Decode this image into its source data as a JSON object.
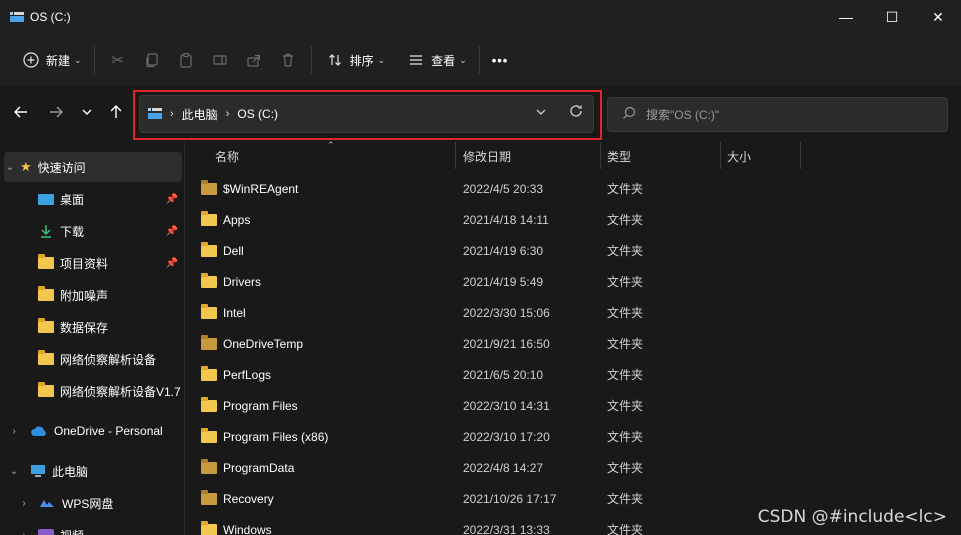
{
  "window": {
    "title": "OS (C:)",
    "minimize_glyph": "—",
    "maximize_glyph": "☐",
    "close_glyph": "✕"
  },
  "toolbar": {
    "new_label": "新建",
    "sort_label": "排序",
    "view_label": "查看",
    "more_label": "•••"
  },
  "address": {
    "crumbs": [
      "此电脑",
      "OS (C:)"
    ]
  },
  "search": {
    "placeholder": "搜索\"OS (C:)\""
  },
  "sidebar": {
    "quick_access": "快速访问",
    "items": [
      {
        "label": "桌面",
        "pinned": true
      },
      {
        "label": "下载",
        "pinned": true
      },
      {
        "label": "项目资料",
        "pinned": true
      },
      {
        "label": "附加噪声",
        "pinned": false
      },
      {
        "label": "数据保存",
        "pinned": false
      },
      {
        "label": "网络侦察解析设备",
        "pinned": false
      },
      {
        "label": "网络侦察解析设备V1.7",
        "pinned": false
      }
    ],
    "onedrive": "OneDrive - Personal",
    "this_pc": "此电脑",
    "wps": "WPS网盘",
    "videos": "视频"
  },
  "columns": {
    "name": "名称",
    "modified": "修改日期",
    "type": "类型",
    "size": "大小"
  },
  "files": [
    {
      "name": "$WinREAgent",
      "date": "2022/4/5 20:33",
      "type": "文件夹",
      "hidden": true
    },
    {
      "name": "Apps",
      "date": "2021/4/18 14:11",
      "type": "文件夹",
      "hidden": false
    },
    {
      "name": "Dell",
      "date": "2021/4/19 6:30",
      "type": "文件夹",
      "hidden": false
    },
    {
      "name": "Drivers",
      "date": "2021/4/19 5:49",
      "type": "文件夹",
      "hidden": false
    },
    {
      "name": "Intel",
      "date": "2022/3/30 15:06",
      "type": "文件夹",
      "hidden": false
    },
    {
      "name": "OneDriveTemp",
      "date": "2021/9/21 16:50",
      "type": "文件夹",
      "hidden": true
    },
    {
      "name": "PerfLogs",
      "date": "2021/6/5 20:10",
      "type": "文件夹",
      "hidden": false
    },
    {
      "name": "Program Files",
      "date": "2022/3/10 14:31",
      "type": "文件夹",
      "hidden": false
    },
    {
      "name": "Program Files (x86)",
      "date": "2022/3/10 17:20",
      "type": "文件夹",
      "hidden": false
    },
    {
      "name": "ProgramData",
      "date": "2022/4/8 14:27",
      "type": "文件夹",
      "hidden": true
    },
    {
      "name": "Recovery",
      "date": "2021/10/26 17:17",
      "type": "文件夹",
      "hidden": true
    },
    {
      "name": "Windows",
      "date": "2022/3/31 13:33",
      "type": "文件夹",
      "hidden": false
    }
  ],
  "watermark": "CSDN @#include<lc>",
  "colors": {
    "highlight_border": "#e0262b",
    "folder": "#f3c74e",
    "background": "#191919"
  }
}
